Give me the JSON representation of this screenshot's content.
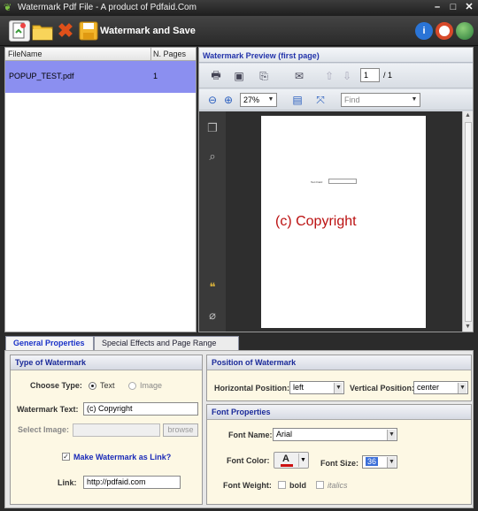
{
  "window": {
    "title": "Watermark Pdf File - A product of Pdfaid.Com",
    "controls": {
      "minimize": "–",
      "maximize": "□",
      "close": "✕"
    }
  },
  "toolbar": {
    "heading": "Watermark and Save",
    "icons": [
      "add-file-icon",
      "open-folder-icon",
      "delete-icon",
      "save-icon"
    ],
    "right_icons": [
      "info-icon",
      "help-lifebuoy-icon",
      "globe-icon"
    ],
    "colors": {
      "info": "#2a74d6",
      "help": "#d84a2a",
      "globe": "#3a9a4a"
    }
  },
  "filelist": {
    "columns": [
      "FileName",
      "N. Pages"
    ],
    "rows": [
      {
        "name": "POPUP_TEST.pdf",
        "pages": "1"
      }
    ],
    "selected_color": "#8b8ff0"
  },
  "preview": {
    "title": "Watermark Preview (first page)",
    "page_current": "1",
    "page_total": "/ 1",
    "zoom": "27%",
    "find_placeholder": "Find",
    "watermark_text": "(c) Copyright",
    "watermark_color": "#b11111"
  },
  "tabs": [
    {
      "label": "General Properties",
      "active": true
    },
    {
      "label": "Special Effects and Page Range",
      "active": false
    }
  ],
  "type_of_watermark": {
    "title": "Type of Watermark",
    "choose_type_label": "Choose Type:",
    "options": [
      "Text",
      "Image"
    ],
    "selected": "Text",
    "watermark_text_label": "Watermark Text:",
    "watermark_text_value": "(c) Copyright",
    "select_image_label": "Select Image:",
    "select_image_value": "",
    "browse_label": "browse",
    "link_checkbox_label": "Make Watermark as Link?",
    "link_checked": true,
    "link_label": "Link:",
    "link_value": "http://pdfaid.com"
  },
  "position": {
    "title": "Position of Watermark",
    "horizontal_label": "Horizontal Position:",
    "horizontal_value": "left",
    "vertical_label": "Vertical Position:",
    "vertical_value": "center"
  },
  "font": {
    "title": "Font Properties",
    "name_label": "Font Name:",
    "name_value": "Arial",
    "color_label": "Font Color:",
    "color_glyph": "A",
    "color_value": "#cc1111",
    "size_label": "Font Size:",
    "size_value": "36",
    "weight_label": "Font Weight:",
    "bold_label": "bold",
    "italics_label": "italics"
  }
}
